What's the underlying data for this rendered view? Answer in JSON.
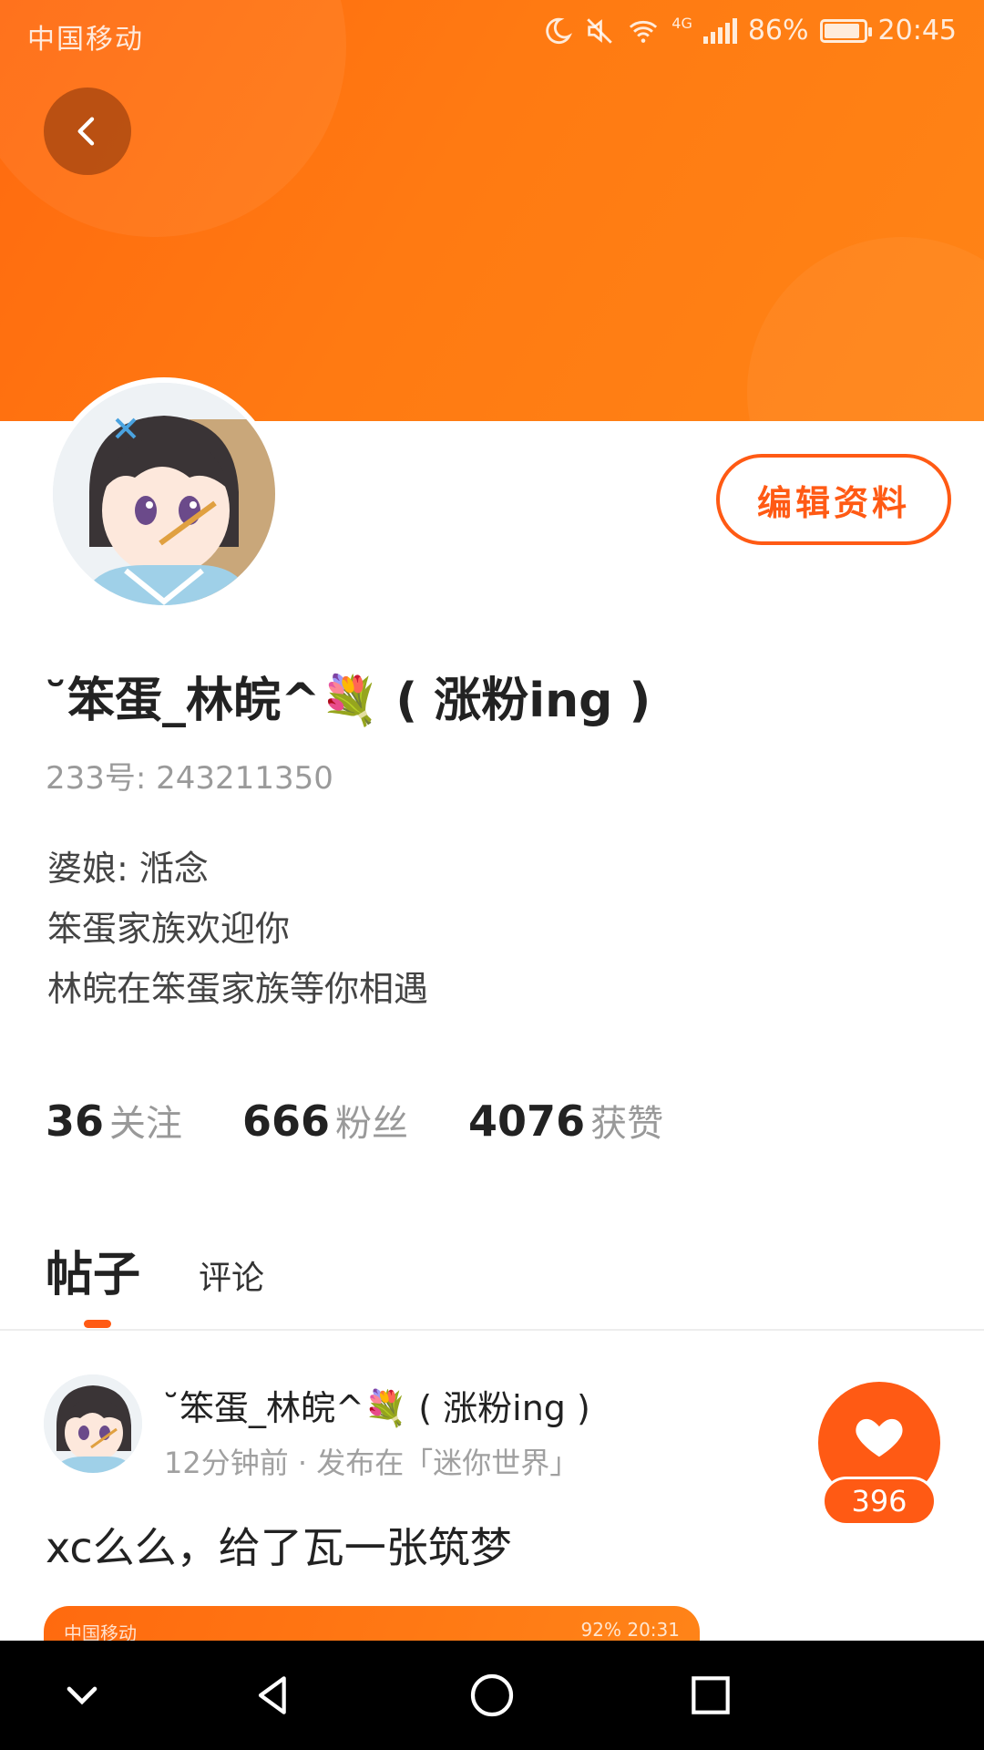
{
  "status_bar": {
    "carrier": "中国移动",
    "battery_percent": "86%",
    "time": "20:45",
    "network": "4G",
    "icons": [
      "moon-icon",
      "mute-icon",
      "wifi-icon",
      "signal-icon",
      "battery-icon"
    ]
  },
  "header": {
    "back_icon": "chevron-left-icon",
    "banner_color": "#ff7411"
  },
  "profile": {
    "edit_label": "编辑资料",
    "nickname": "˘笨蛋_林皖^💐 ( 涨粉ing )",
    "uid": "233号: 243211350",
    "bio": [
      "婆娘: 湉念",
      "笨蛋家族欢迎你",
      "林皖在笨蛋家族等你相遇"
    ],
    "stats": [
      {
        "value": "36",
        "label": "关注"
      },
      {
        "value": "666",
        "label": "粉丝"
      },
      {
        "value": "4076",
        "label": "获赞"
      }
    ]
  },
  "tabs": {
    "posts": "帖子",
    "comments": "评论",
    "active": "posts"
  },
  "post": {
    "author": "˘笨蛋_林皖^💐 ( 涨粉ing )",
    "meta": "12分钟前 · 发布在「迷你世界」",
    "text": "xc么么，给了瓦一张筑梦",
    "likes": "396",
    "image_carrier": "中国移动",
    "image_status": "92%  20:31"
  },
  "colors": {
    "accent": "#ff5a14",
    "banner": "#ff7411"
  }
}
